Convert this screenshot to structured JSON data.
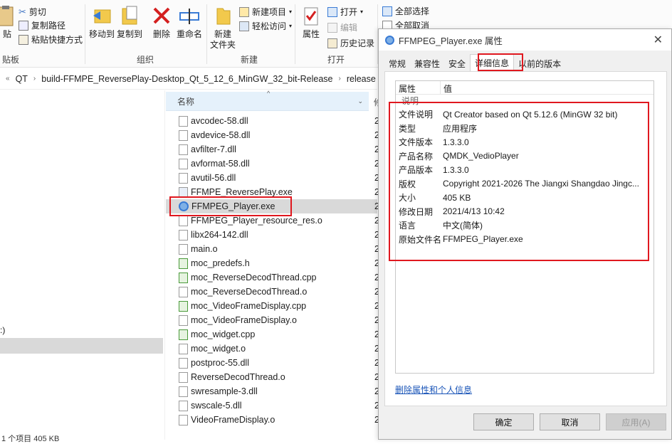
{
  "ribbon": {
    "clipboard": {
      "paste_label": "贴",
      "cut_label": "剪切",
      "copy_path_label": "复制路径",
      "paste_shortcut_label": "粘贴快捷方式",
      "group_label": "贴板"
    },
    "organize": {
      "move_to_label": "移动到",
      "copy_to_label": "复制到",
      "delete_label": "删除",
      "rename_label": "重命名",
      "group_label": "组织"
    },
    "new": {
      "new_folder_label_line1": "新建",
      "new_folder_label_line2": "文件夹",
      "new_item_label": "新建项目",
      "easy_access_label": "轻松访问",
      "group_label": "新建"
    },
    "open": {
      "properties_label": "属性",
      "open_label": "打开",
      "edit_label": "编辑",
      "history_label": "历史记录",
      "group_label": "打开"
    },
    "select": {
      "select_all_label": "全部选择",
      "select_none_label": "全部取消"
    }
  },
  "address": {
    "segments": [
      "QT",
      "build-FFMPE_ReversePlay-Desktop_Qt_5_12_6_MinGW_32_bit-Release",
      "release"
    ]
  },
  "nav": {
    "partial_text": ":)"
  },
  "filelist": {
    "column_name": "名称",
    "column_date_fragment": "修",
    "files": [
      {
        "name": "avcodec-58.dll",
        "date_fragment": "2"
      },
      {
        "name": "avdevice-58.dll",
        "date_fragment": "2"
      },
      {
        "name": "avfilter-7.dll",
        "date_fragment": "2"
      },
      {
        "name": "avformat-58.dll",
        "date_fragment": "2"
      },
      {
        "name": "avutil-56.dll",
        "date_fragment": "2"
      },
      {
        "name": "FFMPE_ReversePlay.exe",
        "date_fragment": "2"
      },
      {
        "name": "FFMPEG_Player.exe",
        "date_fragment": "2"
      },
      {
        "name": "FFMPEG_Player_resource_res.o",
        "date_fragment": "2"
      },
      {
        "name": "libx264-142.dll",
        "date_fragment": "2"
      },
      {
        "name": "main.o",
        "date_fragment": "2"
      },
      {
        "name": "moc_predefs.h",
        "date_fragment": "2"
      },
      {
        "name": "moc_ReverseDecodThread.cpp",
        "date_fragment": "2"
      },
      {
        "name": "moc_ReverseDecodThread.o",
        "date_fragment": "2"
      },
      {
        "name": "moc_VideoFrameDisplay.cpp",
        "date_fragment": "2"
      },
      {
        "name": "moc_VideoFrameDisplay.o",
        "date_fragment": "2"
      },
      {
        "name": "moc_widget.cpp",
        "date_fragment": "2"
      },
      {
        "name": "moc_widget.o",
        "date_fragment": "2"
      },
      {
        "name": "postproc-55.dll",
        "date_fragment": "2"
      },
      {
        "name": "ReverseDecodThread.o",
        "date_fragment": "2"
      },
      {
        "name": "swresample-3.dll",
        "date_fragment": "2"
      },
      {
        "name": "swscale-5.dll",
        "date_fragment": "2"
      },
      {
        "name": "VideoFrameDisplay.o",
        "date_fragment": "2"
      }
    ]
  },
  "statusbar": {
    "text": "1 个项目  405 KB"
  },
  "dialog": {
    "title": "FFMPEG_Player.exe 属性",
    "tabs": [
      "常规",
      "兼容性",
      "安全",
      "详细信息",
      "以前的版本"
    ],
    "table_header": {
      "property": "属性",
      "value": "值"
    },
    "section_label": "说明",
    "properties": [
      {
        "k": "文件说明",
        "v": "Qt Creator based on Qt 5.12.6 (MinGW 32 bit)"
      },
      {
        "k": "类型",
        "v": "应用程序"
      },
      {
        "k": "文件版本",
        "v": "1.3.3.0"
      },
      {
        "k": "产品名称",
        "v": "QMDK_VedioPlayer"
      },
      {
        "k": "产品版本",
        "v": "1.3.3.0"
      },
      {
        "k": "版权",
        "v": "Copyright 2021-2026 The Jiangxi Shangdao Jingc..."
      },
      {
        "k": "大小",
        "v": "405 KB"
      },
      {
        "k": "修改日期",
        "v": "2021/4/13 10:42"
      },
      {
        "k": "语言",
        "v": "中文(简体)"
      },
      {
        "k": "原始文件名",
        "v": "FFMPEG_Player.exe"
      }
    ],
    "remove_link": "删除属性和个人信息",
    "buttons": {
      "ok": "确定",
      "cancel": "取消",
      "apply": "应用(A)"
    }
  },
  "colors": {
    "highlight": "#e0181f",
    "selection": "#d9d9d9",
    "link": "#1a55b8"
  }
}
